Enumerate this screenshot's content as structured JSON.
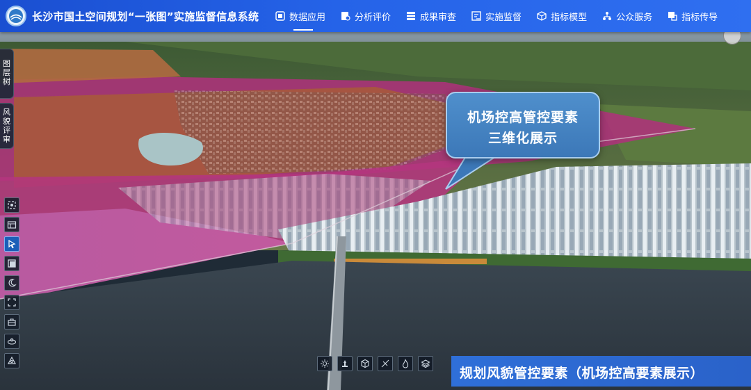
{
  "header": {
    "system_title": "长沙市国土空间规划“一张图”实施监督信息系统",
    "logo_icon": "city-emblem-icon"
  },
  "nav": {
    "items": [
      {
        "label": "数据应用",
        "icon": "data-app-icon",
        "active": true
      },
      {
        "label": "分析评价",
        "icon": "analysis-icon",
        "active": false
      },
      {
        "label": "成果审查",
        "icon": "review-icon",
        "active": false
      },
      {
        "label": "实施监督",
        "icon": "supervise-icon",
        "active": false
      },
      {
        "label": "指标模型",
        "icon": "cube-icon",
        "active": false
      },
      {
        "label": "公众服务",
        "icon": "org-icon",
        "active": false
      },
      {
        "label": "指标传导",
        "icon": "transmit-icon",
        "active": false
      }
    ]
  },
  "side_tabs": {
    "layer_tree": "图层树",
    "style_review": "风貌评审"
  },
  "left_toolbar": [
    "locate-icon",
    "map-icon",
    "select-arrow-icon",
    "square-icon",
    "night-mode-icon",
    "fullscreen-icon",
    "toolbox-icon",
    "view-360-icon",
    "measure-icon"
  ],
  "bottom_toolbar": [
    "sunlight-icon",
    "weather-icon",
    "model-cube-icon",
    "no-fly-icon",
    "fire-icon",
    "layers-icon"
  ],
  "callout": {
    "line1": "机场控高管控要素",
    "line2": "三维化展示"
  },
  "caption": {
    "text": "规划风貌管控要素（机场控高要素展示）"
  },
  "colors": {
    "header_blue": "#2563e8",
    "control_zone_magenta": "#b0307c",
    "caption_blue": "#2f6fd8"
  }
}
